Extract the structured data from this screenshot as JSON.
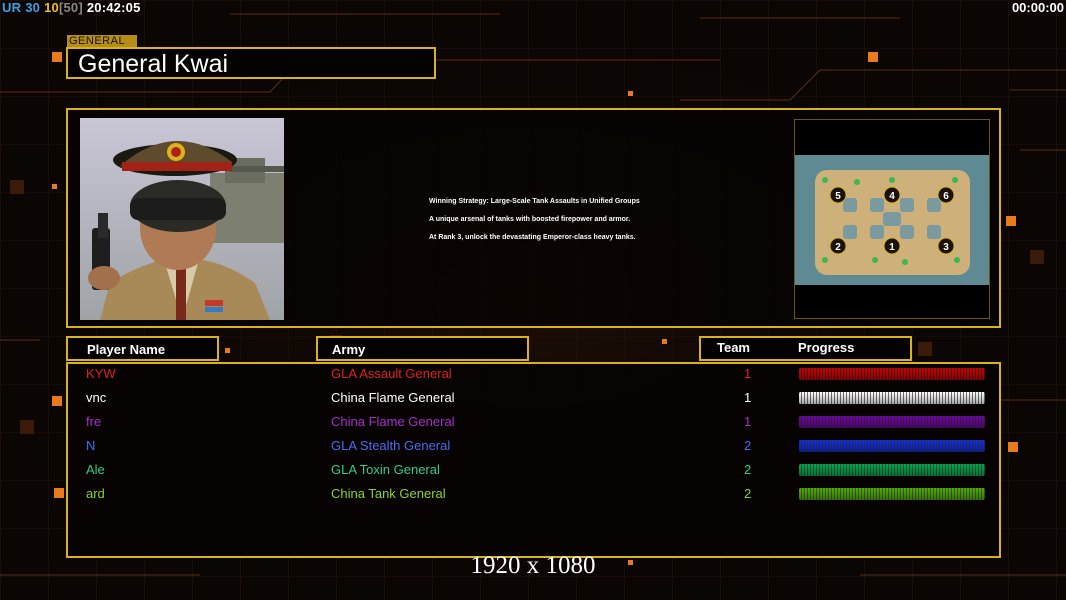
{
  "stats": {
    "ur_label": "UR",
    "fps": "30",
    "logic": "10",
    "logic_cap": "[50]",
    "time": "20:42:05",
    "timer": "00:00:00"
  },
  "general": {
    "tag": "GENERAL",
    "name": "General Kwai"
  },
  "strategy": {
    "lines": [
      "Winning Strategy: Large-Scale Tank Assaults in Unified Groups",
      "A unique arsenal of tanks with boosted firepower and armor.",
      "At Rank 3, unlock the devastating Emperor-class heavy tanks."
    ]
  },
  "map": {
    "slots": [
      "5",
      "4",
      "6",
      "2",
      "1",
      "3"
    ]
  },
  "headers": {
    "player_name": "Player Name",
    "army": "Army",
    "team": "Team",
    "progress": "Progress"
  },
  "players": [
    {
      "name": "KYW",
      "army": "GLA Assault General",
      "team": "1",
      "progress": 1.0,
      "color": "#e0211f"
    },
    {
      "name": "vnc",
      "army": "China Flame General",
      "team": "1",
      "progress": 1.0,
      "color": "#ffffff"
    },
    {
      "name": "fre",
      "army": "China Flame General",
      "team": "1",
      "progress": 1.0,
      "color": "#a52fc9"
    },
    {
      "name": "N",
      "army": "GLA Stealth General",
      "team": "2",
      "progress": 1.0,
      "color": "#4a6cf0"
    },
    {
      "name": "Ale",
      "army": "GLA Toxin General",
      "team": "2",
      "progress": 1.0,
      "color": "#2fcf8a"
    },
    {
      "name": "ard",
      "army": "China Tank General",
      "team": "2",
      "progress": 1.0,
      "color": "#8ed32a"
    }
  ],
  "resolution": "1920 x 1080",
  "colors": {
    "accent_gold": "#d9b21c",
    "ur_color": "#3aa0e8",
    "fps_color": "#3aa0e8",
    "logic_color": "#f0c020"
  }
}
